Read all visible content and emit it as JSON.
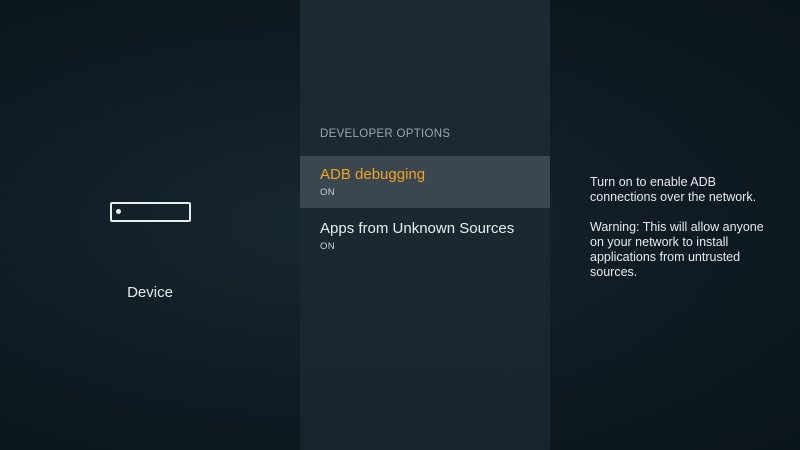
{
  "left": {
    "icon": "fire-tv-device-icon",
    "label": "Device"
  },
  "middle": {
    "section_header": "DEVELOPER OPTIONS",
    "items": [
      {
        "title": "ADB debugging",
        "value": "ON",
        "selected": true
      },
      {
        "title": "Apps from Unknown Sources",
        "value": "ON",
        "selected": false
      }
    ]
  },
  "right": {
    "description": "Turn on to enable ADB connections over the network.",
    "warning": "Warning: This will allow anyone on your network to install applications from untrusted sources."
  },
  "colors": {
    "accent": "#f0a326",
    "selected_bg": "#3a474e",
    "background": "#0f1a21"
  }
}
